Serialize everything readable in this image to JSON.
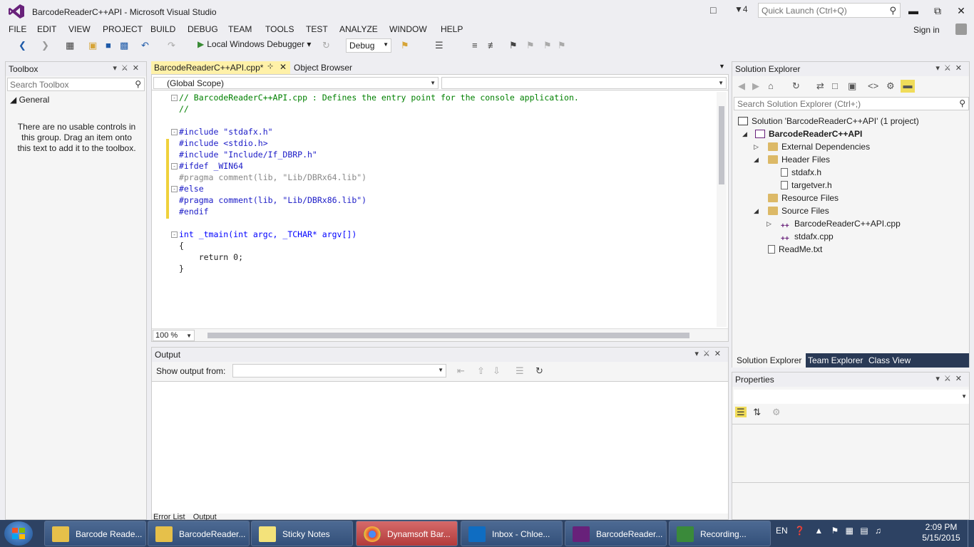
{
  "window": {
    "title": "BarcodeReaderC++API - Microsoft Visual Studio",
    "quick_launch_placeholder": "Quick Launch (Ctrl+Q)",
    "notification_count": "4",
    "signin_label": "Sign in"
  },
  "menu": [
    "FILE",
    "EDIT",
    "VIEW",
    "PROJECT",
    "BUILD",
    "DEBUG",
    "TEAM",
    "TOOLS",
    "TEST",
    "ANALYZE",
    "WINDOW",
    "HELP"
  ],
  "toolbar": {
    "debugger_label": "Local Windows Debugger",
    "configuration": "Debug"
  },
  "toolbox": {
    "title": "Toolbox",
    "search_placeholder": "Search Toolbox",
    "group": "General",
    "empty_message": "There are no usable controls in this group. Drag an item onto this text to add it to the toolbox."
  },
  "editor": {
    "tabs": [
      {
        "label": "BarcodeReaderC++API.cpp*",
        "pinned": true
      },
      {
        "label": "Object Browser"
      }
    ],
    "scope": "(Global Scope)",
    "zoom": "100 %",
    "lines": [
      "// BarcodeReaderC++API.cpp : Defines the entry point for the console application.",
      "//",
      "",
      "#include \"stdafx.h\"",
      "#include <stdio.h>",
      "#include \"Include/If_DBRP.h\"",
      "#ifdef _WIN64",
      "#pragma comment(lib, \"Lib/DBRx64.lib\")",
      "#else",
      "#pragma comment(lib, \"Lib/DBRx86.lib\")",
      "#endif",
      "",
      "int _tmain(int argc, _TCHAR* argv[])",
      "{",
      "    return 0;",
      "}"
    ]
  },
  "output": {
    "title": "Output",
    "show_from_label": "Show output from:",
    "tabs": [
      "Error List",
      "Output"
    ]
  },
  "solution_explorer": {
    "title": "Solution Explorer",
    "search_placeholder": "Search Solution Explorer (Ctrl+;)",
    "solution": "Solution 'BarcodeReaderC++API' (1 project)",
    "project": "BarcodeReaderC++API",
    "items": [
      {
        "label": "External Dependencies"
      },
      {
        "label": "Header Files"
      },
      {
        "label": "stdafx.h"
      },
      {
        "label": "targetver.h"
      },
      {
        "label": "Resource Files"
      },
      {
        "label": "Source Files"
      },
      {
        "label": "BarcodeReaderC++API.cpp"
      },
      {
        "label": "stdafx.cpp"
      },
      {
        "label": "ReadMe.txt"
      }
    ],
    "bottom_tabs": [
      "Solution Explorer",
      "Team Explorer",
      "Class View"
    ]
  },
  "properties": {
    "title": "Properties"
  },
  "taskbar": {
    "tasks": [
      {
        "label": "Barcode Reade...",
        "icon": "folder-icon",
        "color": "#e6c04a"
      },
      {
        "label": "BarcodeReader...",
        "icon": "folder-icon",
        "color": "#e6c04a"
      },
      {
        "label": "Sticky Notes",
        "icon": "sticky-notes-icon",
        "color": "#f3e27a"
      },
      {
        "label": "Dynamsoft Bar...",
        "icon": "chrome-icon",
        "color": "#e04a3a"
      },
      {
        "label": "Inbox - Chloe...",
        "icon": "outlook-icon",
        "color": "#0f6dc2"
      },
      {
        "label": "BarcodeReader...",
        "icon": "visual-studio-icon",
        "color": "#68217a"
      },
      {
        "label": "Recording...",
        "icon": "camtasia-icon",
        "color": "#3a8a3a"
      }
    ],
    "language": "EN",
    "time": "2:09 PM",
    "date": "5/15/2015"
  }
}
